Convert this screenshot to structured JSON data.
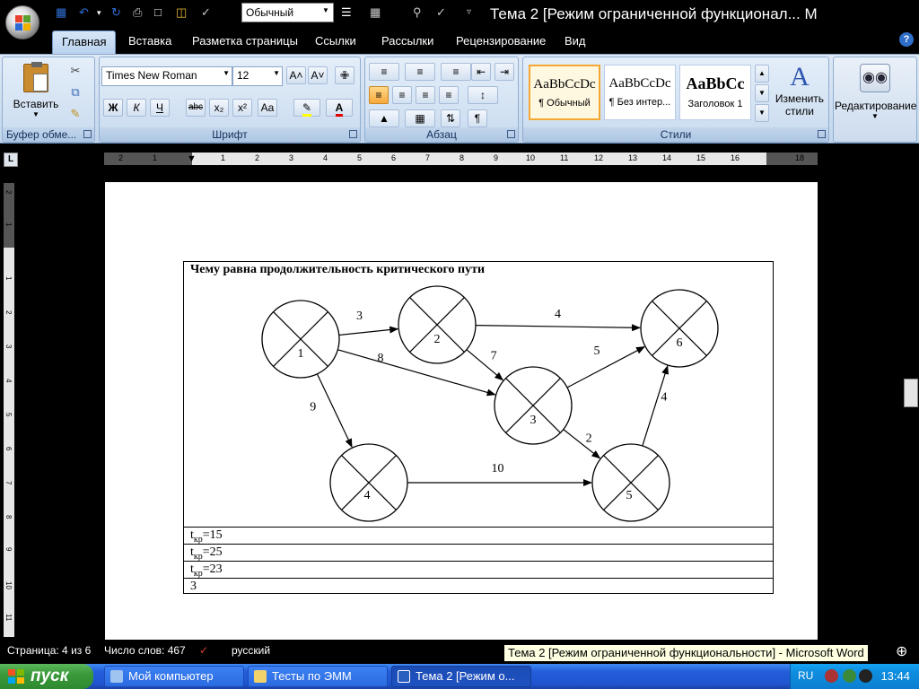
{
  "window": {
    "title": "Тема 2 [Режим ограниченной функционал... М",
    "style_combo_value": "Обычный"
  },
  "tabs": [
    "Главная",
    "Вставка",
    "Разметка страницы",
    "Ссылки",
    "Рассылки",
    "Рецензирование",
    "Вид"
  ],
  "ribbon": {
    "clipboard": {
      "paste_label": "Вставить",
      "group_label": "Буфер обме..."
    },
    "font": {
      "font_name": "Times New Roman",
      "font_size": "12",
      "bold": "Ж",
      "italic": "К",
      "underline": "Ч",
      "strike": "abc",
      "subscript": "x₂",
      "superscript": "x²",
      "change_case": "Aa",
      "grow": "A˄",
      "shrink": "A˅",
      "group_label": "Шрифт"
    },
    "paragraph": {
      "group_label": "Абзац",
      "pilcrow": "¶"
    },
    "styles": {
      "tiles": [
        {
          "sample": "AaBbCcDc",
          "name": "¶ Обычный"
        },
        {
          "sample": "AaBbCcDc",
          "name": "¶ Без интер..."
        },
        {
          "sample": "AaBbCc",
          "name": "Заголовок 1"
        }
      ],
      "change_styles_label": "Изменить стили",
      "group_label": "Стили"
    },
    "editing": {
      "label": "Редактирование"
    }
  },
  "ruler": {
    "h_numbers": [
      "2",
      "1",
      "1",
      "2",
      "3",
      "4",
      "5",
      "6",
      "7",
      "8",
      "9",
      "10",
      "11",
      "12",
      "13",
      "14",
      "15",
      "16",
      "18"
    ],
    "v_numbers": [
      "2",
      "1",
      "1",
      "2",
      "3",
      "4",
      "5",
      "6",
      "7",
      "8",
      "9",
      "10",
      "11"
    ]
  },
  "document": {
    "question": "Чему равна продолжительность критического пути",
    "answers": [
      {
        "main": "t",
        "sub": "кр",
        "rest": "=15"
      },
      {
        "main": "t",
        "sub": "кр",
        "rest": "=25"
      },
      {
        "main": "t",
        "sub": "кр",
        "rest": "=23"
      },
      {
        "main": "3",
        "sub": "",
        "rest": ""
      }
    ],
    "graph": {
      "nodes": [
        {
          "id": "1"
        },
        {
          "id": "2"
        },
        {
          "id": "3"
        },
        {
          "id": "4"
        },
        {
          "id": "5"
        },
        {
          "id": "6"
        }
      ],
      "edges": [
        {
          "from": "1",
          "to": "2",
          "weight": "3"
        },
        {
          "from": "2",
          "to": "6",
          "weight": "4"
        },
        {
          "from": "2",
          "to": "3",
          "weight": "7"
        },
        {
          "from": "1",
          "to": "3",
          "weight": "8"
        },
        {
          "from": "3",
          "to": "6",
          "weight": "5"
        },
        {
          "from": "1",
          "to": "4",
          "weight": "9"
        },
        {
          "from": "3",
          "to": "5",
          "weight": "2"
        },
        {
          "from": "5",
          "to": "6",
          "weight": "4"
        },
        {
          "from": "4",
          "to": "5",
          "weight": "10"
        }
      ]
    }
  },
  "status": {
    "page": "Страница: 4 из 6",
    "words": "Число слов: 467",
    "language": "русский",
    "tooltip": "Тема 2 [Режим ограниченной функциональности] - Microsoft Word"
  },
  "taskbar": {
    "start": "пуск",
    "tasks": [
      "Мой компьютер",
      "Тесты по ЭММ",
      "Тема 2 [Режим о..."
    ],
    "lang": "RU",
    "clock": "13:44"
  }
}
